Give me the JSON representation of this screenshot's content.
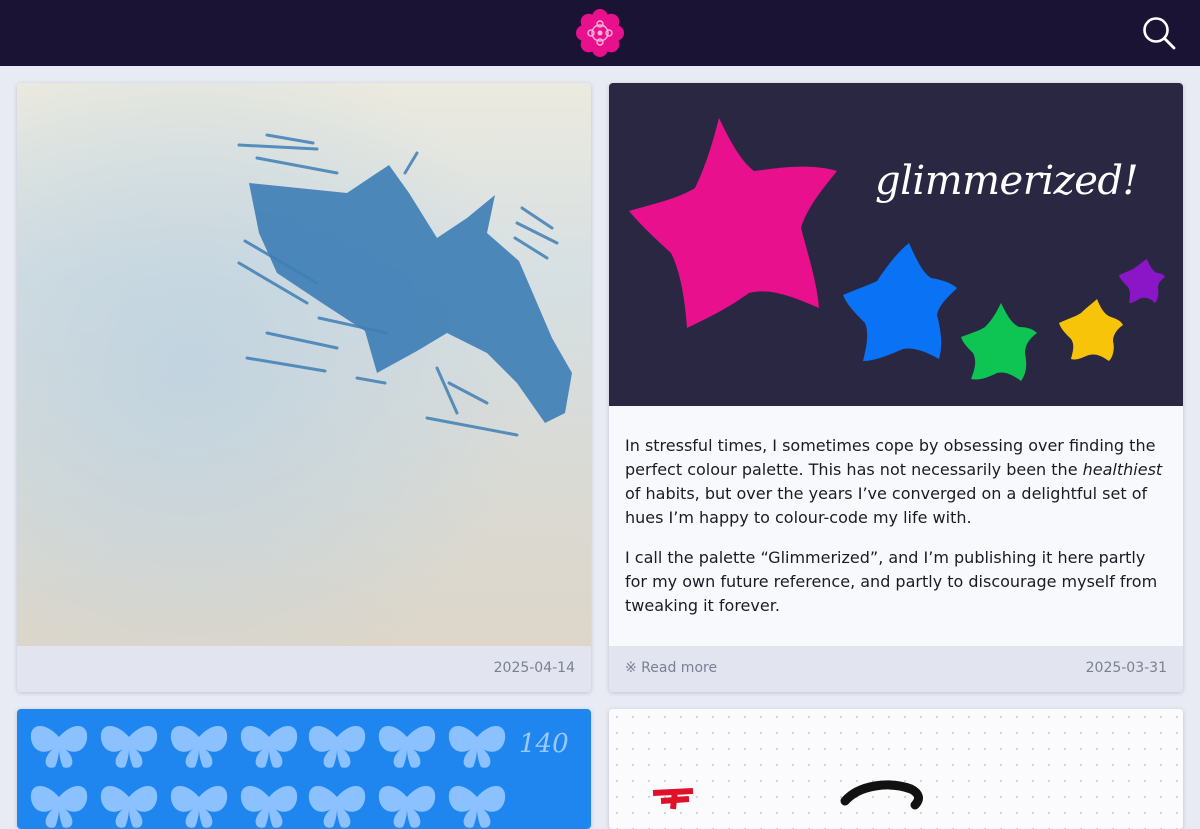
{
  "header": {
    "logo_icon": "flower-logo-icon",
    "search_icon": "search-icon"
  },
  "posts": [
    {
      "date": "2025-04-14",
      "image": "bird-linocut-print"
    },
    {
      "image_title": "glimmerized!",
      "excerpt_p1_before": "In stressful times, I sometimes cope by obsessing over finding the perfect colour palette. This has not necessarily been the ",
      "excerpt_p1_em": "healthiest",
      "excerpt_p1_after": " of habits, but over the years I’ve converged on a delightful set of hues I’m happy to colour-code my life with.",
      "excerpt_p2": "I call the palette “Glimmerized”, and I’m publishing it here partly for my own future reference, and partly to discourage myself from tweaking it forever.",
      "read_more": "※ Read more",
      "date": "2025-03-31",
      "star_colors": [
        "#e8108c",
        "#0a72f5",
        "#0ec452",
        "#f8c40a",
        "#8a16c7"
      ]
    },
    {
      "image_number": "140",
      "image": "butterfly-grid"
    },
    {
      "image": "dotted-sketch"
    }
  ],
  "colors": {
    "header_bg": "#1a1333",
    "page_bg": "#e9ebf4",
    "card_footer": "#e2e4ef",
    "accent": "#e8108c"
  }
}
